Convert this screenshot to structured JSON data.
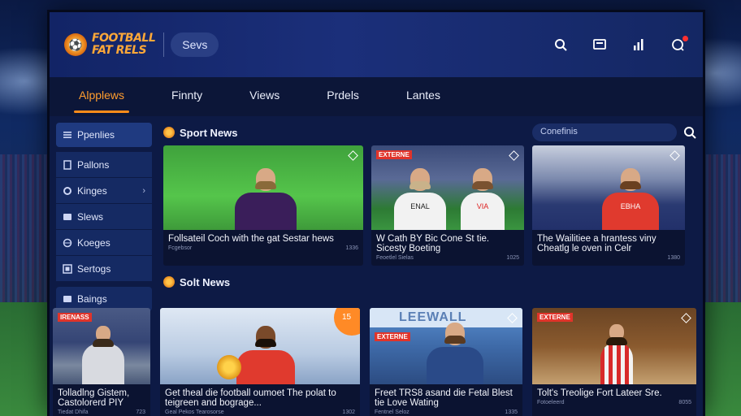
{
  "brand": {
    "line1": "FOOTBALL",
    "line2": "FAT RELS",
    "search_label": "Sevs"
  },
  "topbar_icons": [
    "search-icon",
    "tv-icon",
    "stats-icon",
    "notification-icon"
  ],
  "tabs": [
    {
      "label": "Alpplews",
      "active": true
    },
    {
      "label": "Finnty",
      "active": false
    },
    {
      "label": "Views",
      "active": false
    },
    {
      "label": "Prdels",
      "active": false
    },
    {
      "label": "Lantes",
      "active": false
    }
  ],
  "sidebar": {
    "items": [
      {
        "label": "Ppenlies",
        "icon": "list-icon"
      },
      {
        "label": "Pallons",
        "icon": "doc-icon"
      },
      {
        "label": "Kinges",
        "icon": "gear-icon",
        "has_chevron": true
      },
      {
        "label": "Slews",
        "icon": "card-icon"
      },
      {
        "label": "Koeges",
        "icon": "globe-icon"
      },
      {
        "label": "Sertogs",
        "icon": "grid-icon"
      },
      {
        "label": "Baings",
        "icon": "card-icon"
      }
    ]
  },
  "sections": [
    {
      "title": "Sport News",
      "search_placeholder": "Conefinis",
      "cards": [
        {
          "title": "Follsateil Coch with the gat Sestar hews",
          "meta_left": "Fcgebsor",
          "meta_right": "1336",
          "badge": "",
          "corner": ""
        },
        {
          "title": "W Cath BY Bic Cone St tie. Sicesty Boeting",
          "meta_left": "Feoetlel Sielas",
          "meta_right": "1025",
          "badge": "EXTERNE",
          "corner": "",
          "shirt_text_a": "ENAL",
          "shirt_text_b": "VIA"
        },
        {
          "title": "The Wailitiee a hrantess viny Cheatlg le oven in Celr",
          "meta_left": "",
          "meta_right": "1380",
          "badge": "",
          "corner": "",
          "shirt_text": "EBHA"
        }
      ]
    },
    {
      "title": "Solt News",
      "cards": [
        {
          "title": "Tolladlng Gistem, Castolorerd PIY",
          "meta_left": "Tiedat Dhifa",
          "meta_right": "723",
          "badge": "IRENASS",
          "corner": ""
        },
        {
          "title": "Get theal die football oumoet The polat to teigreen and bograge...",
          "meta_left": "Geal Pekos Tearosorse",
          "meta_right": "1302",
          "badge": "",
          "corner": "15"
        },
        {
          "title": "Freet TRS8 asand die Fetal Blest tie Love Wating",
          "meta_left": "Fentnel Seloz",
          "meta_right": "1335",
          "badge": "EXTERNE",
          "corner": "",
          "banner": "LEEWALL"
        },
        {
          "title": "Tolt's Treolige Fort Lateer Sre.",
          "meta_left": "Fotoeleerd",
          "meta_right": "8055",
          "badge": "EXTERNE",
          "corner": ""
        }
      ]
    }
  ],
  "colors": {
    "accent": "#ff9d2e",
    "badge": "#e0342a",
    "panel": "#0d1a45"
  }
}
